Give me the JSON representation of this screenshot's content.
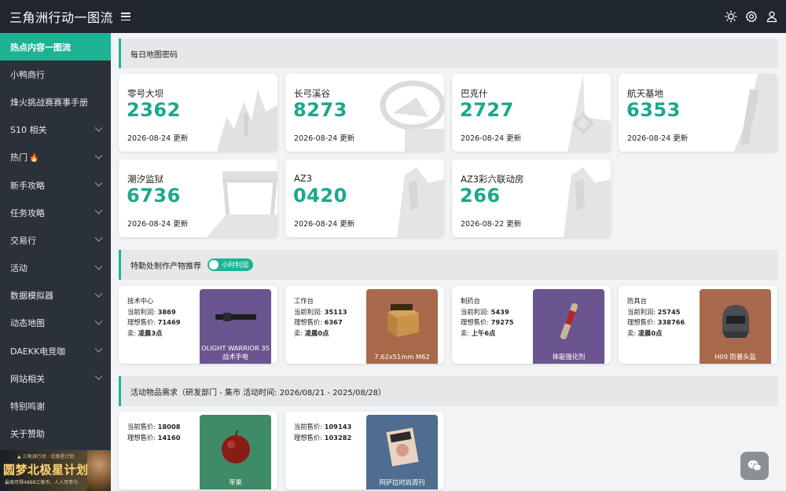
{
  "app": {
    "title": "三角洲行动一图流"
  },
  "sidebar": {
    "items": [
      {
        "label": "热点内容一图流",
        "active": true,
        "has_submenu": false
      },
      {
        "label": "小鸭商行",
        "has_submenu": false
      },
      {
        "label": "烽火挑战赛赛事手册",
        "has_submenu": false
      },
      {
        "label": "S10 相关",
        "has_submenu": true
      },
      {
        "label": "热门",
        "has_submenu": true,
        "icon": "fire-icon"
      },
      {
        "label": "新手攻略",
        "has_submenu": true
      },
      {
        "label": "任务攻略",
        "has_submenu": true
      },
      {
        "label": "交易行",
        "has_submenu": true
      },
      {
        "label": "活动",
        "has_submenu": true
      },
      {
        "label": "数据模拟器",
        "has_submenu": true
      },
      {
        "label": "动态地图",
        "has_submenu": true
      },
      {
        "label": "DAEKK电竞咖",
        "has_submenu": true
      },
      {
        "label": "网站相关",
        "has_submenu": true
      },
      {
        "label": "特别鸣谢",
        "has_submenu": false
      },
      {
        "label": "关于赞助",
        "has_submenu": false
      }
    ],
    "banner": {
      "title": "圆梦北极星计划",
      "top": "▲ 三角洲行动 · 北极星计划",
      "sub": "最高可得4888三角币，人人可参与"
    }
  },
  "daily_codes": {
    "header": "每日地图密码",
    "maps": [
      {
        "name": "零号大坝",
        "code": "2362",
        "date": "2026-08-24 更新"
      },
      {
        "name": "长弓溪谷",
        "code": "8273",
        "date": "2026-08-24 更新"
      },
      {
        "name": "巴克什",
        "code": "2727",
        "date": "2026-08-24 更新"
      },
      {
        "name": "航天基地",
        "code": "6353",
        "date": "2026-08-24 更新"
      },
      {
        "name": "潮汐监狱",
        "code": "6736",
        "date": "2026-08-24 更新"
      },
      {
        "name": "AZ3",
        "code": "0420",
        "date": "2026-08-24 更新"
      },
      {
        "name": "AZ3彩六联动房",
        "code": "266",
        "date": "2026-08-22 更新"
      }
    ]
  },
  "crafting": {
    "header": "特勤处制作产物推荐",
    "toggle_label": "小时利润",
    "items": [
      {
        "station": "技术中心",
        "profit_label": "当前利润:",
        "profit": "3869",
        "ideal_label": "理想售价:",
        "ideal": "71469",
        "sell_label": "卖:",
        "sell": "凌晨3点",
        "item_name": "OLIGHT WARRIOR 3S\n战术手电",
        "tile_color": "#6b5590"
      },
      {
        "station": "工作台",
        "profit_label": "当前利润:",
        "profit": "35113",
        "ideal_label": "理想售价:",
        "ideal": "6367",
        "sell_label": "卖:",
        "sell": "凌晨0点",
        "item_name": "7.62x51mm M62",
        "tile_color": "#a8694a"
      },
      {
        "station": "制药台",
        "profit_label": "当前利润:",
        "profit": "5439",
        "ideal_label": "理想售价:",
        "ideal": "79275",
        "sell_label": "卖:",
        "sell": "上午6点",
        "item_name": "体能强化剂",
        "tile_color": "#6b5590"
      },
      {
        "station": "防具台",
        "profit_label": "当前利润:",
        "profit": "25745",
        "ideal_label": "理想售价:",
        "ideal": "338766",
        "sell_label": "卖:",
        "sell": "凌晨0点",
        "item_name": "H09 防暴头盔",
        "tile_color": "#a8694a"
      }
    ]
  },
  "activity": {
    "header": "活动物品需求（研发部门 - 集市 活动时间: 2026/08/21 - 2025/08/28）",
    "items": [
      {
        "current_label": "当前售价:",
        "current": "18008",
        "ideal_label": "理想售价:",
        "ideal": "14160",
        "item_name": "苹果",
        "tile_color": "#3f8a67"
      },
      {
        "current_label": "当前售价:",
        "current": "109143",
        "ideal_label": "理想售价:",
        "ideal": "103282",
        "item_name": "阿萨拉时尚周刊",
        "tile_color": "#4e6d8f"
      }
    ]
  },
  "icons": {
    "theme": "sun-icon",
    "settings": "gear-icon",
    "user": "user-icon",
    "chat": "wechat-icon"
  },
  "colors": {
    "accent": "#1cb394",
    "code": "#1ba88a",
    "topbar": "#1f2630",
    "sidebar": "#2b3139"
  }
}
